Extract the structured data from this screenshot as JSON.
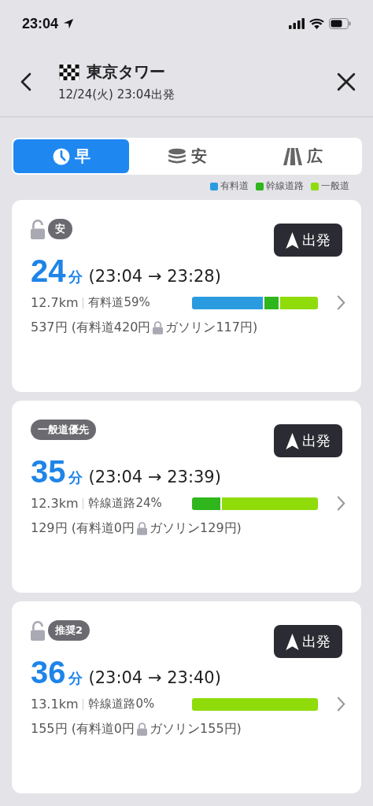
{
  "status_bar": {
    "time": "23:04"
  },
  "header": {
    "destination": "東京タワー",
    "departure": "12/24(火) 23:04出発"
  },
  "tabs": [
    {
      "label": "早",
      "selected": true
    },
    {
      "label": "安",
      "selected": false
    },
    {
      "label": "広",
      "selected": false
    }
  ],
  "legend": [
    {
      "label": "有料道",
      "color": "#2b9be0"
    },
    {
      "label": "幹線道路",
      "color": "#2fb61c"
    },
    {
      "label": "一般道",
      "color": "#8fdc0a"
    }
  ],
  "routes": [
    {
      "lock": true,
      "badge": "安",
      "depart_button": "出発",
      "minutes": "24",
      "minutes_unit": "分",
      "times": "(23:04 → 23:28)",
      "distance": "12.7km",
      "road_share": "有料道59%",
      "segments": [
        {
          "color": "#2b9be0"
        },
        {
          "color": "#2fb61c"
        },
        {
          "color": "#8fdc0a"
        }
      ],
      "cost": "537円 (有料道420円",
      "gasoline": "ガソリン117円)"
    },
    {
      "lock": false,
      "badge": "一般道優先",
      "depart_button": "出発",
      "minutes": "35",
      "minutes_unit": "分",
      "times": "(23:04 → 23:39)",
      "distance": "12.3km",
      "road_share": "幹線道路24%",
      "segments": [
        {
          "color": "#2fb61c"
        },
        {
          "color": "#8fdc0a"
        }
      ],
      "cost": "129円 (有料道0円",
      "gasoline": "ガソリン129円)"
    },
    {
      "lock": true,
      "badge": "推奨2",
      "depart_button": "出発",
      "minutes": "36",
      "minutes_unit": "分",
      "times": "(23:04 → 23:40)",
      "distance": "13.1km",
      "road_share": "幹線道路0%",
      "segments": [
        {
          "color": "#8fdc0a"
        }
      ],
      "cost": "155円 (有料道0円",
      "gasoline": "ガソリン155円)"
    }
  ]
}
